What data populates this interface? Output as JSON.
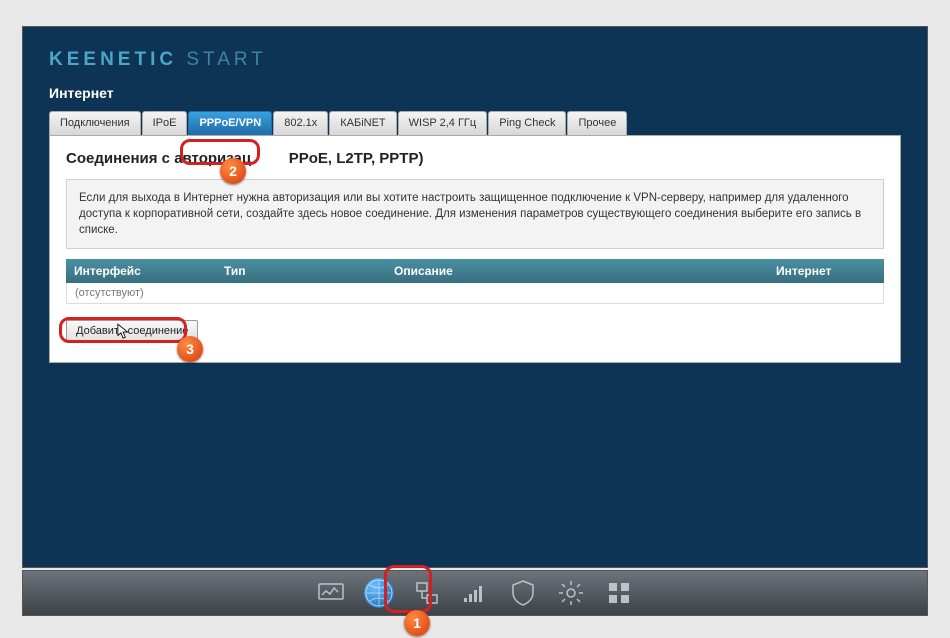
{
  "brand": {
    "main": "KEENETIC",
    "sub": "START"
  },
  "section": "Интернет",
  "tabs": [
    {
      "label": "Подключения"
    },
    {
      "label": "IPoE"
    },
    {
      "label": "PPPoE/VPN",
      "active": true
    },
    {
      "label": "802.1x"
    },
    {
      "label": "КАБiNET"
    },
    {
      "label": "WISP 2,4 ГГц"
    },
    {
      "label": "Ping Check"
    },
    {
      "label": "Прочее"
    }
  ],
  "panel": {
    "heading_prefix": "Соединения с авторизац",
    "heading_suffix": "PPoE, L2TP, PPTP)",
    "info": "Если для выхода в Интернет нужна авторизация или вы хотите настроить защищенное подключение к VPN-серверу, например для удаленного доступа к корпоративной сети, создайте здесь новое соединение. Для изменения параметров существующего соединения выберите его запись в списке.",
    "columns": {
      "iface": "Интерфейс",
      "type": "Тип",
      "desc": "Описание",
      "net": "Интернет"
    },
    "empty": "(отсутствуют)",
    "add_btn": "Добавить соединение"
  },
  "annotations": {
    "1": "1",
    "2": "2",
    "3": "3"
  }
}
